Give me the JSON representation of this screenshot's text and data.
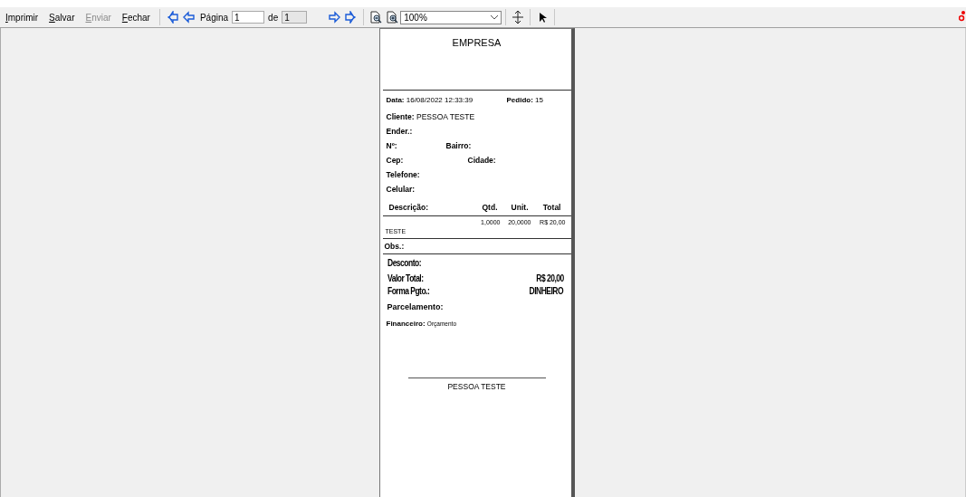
{
  "toolbar": {
    "buttons": [
      {
        "label": "Imprimir",
        "disabled": false
      },
      {
        "label": "Salvar",
        "disabled": false
      },
      {
        "label": "Enviar",
        "disabled": true
      },
      {
        "label": "Fechar",
        "disabled": false
      }
    ],
    "page_label": "Página",
    "page_value": "1",
    "of_label": "de",
    "total_pages": "1",
    "zoom": "100%"
  },
  "report": {
    "company": "EMPRESA",
    "header": [
      {
        "label": "Data:",
        "value": "16/08/2022 12:33:39"
      },
      {
        "label": "Pedido:",
        "value": "15"
      }
    ],
    "client": [
      [
        {
          "label": "Cliente:",
          "value": "PESSOA TESTE"
        }
      ],
      [
        {
          "label": "Ender.:"
        }
      ],
      [
        {
          "label": "Nº:"
        },
        {
          "label": "Bairro:"
        }
      ],
      [
        {
          "label": "Cep:"
        },
        {
          "label": "Cidade:"
        }
      ],
      [
        {
          "label": "Telefone:"
        }
      ],
      [
        {
          "label": "Celular:"
        }
      ]
    ],
    "columns": [
      "Descrição:",
      "Qtd.",
      "Unit.",
      "Total"
    ],
    "items": [
      {
        "description": "TESTE",
        "qty": "1,0000",
        "unit": "20,0000",
        "total": "R$ 20,00"
      }
    ],
    "obs_label": "Obs.:",
    "discount_label": "Desconto:",
    "total_label": "Valor Total:",
    "total_value": "R$ 20,00",
    "payment_label": "Forma Pgto.:",
    "payment_value": "DINHEIRO",
    "installments_label": "Parcelamento:",
    "financial_label": "Financeiro:",
    "financial_value": "Orçamento",
    "signature": "PESSOA TESTE"
  }
}
